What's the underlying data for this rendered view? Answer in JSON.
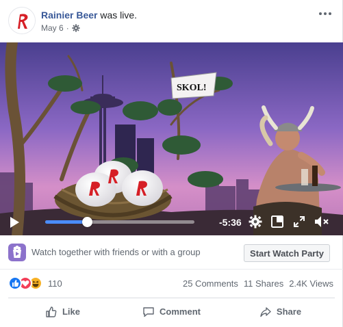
{
  "header": {
    "page_name": "Rainier Beer",
    "status": " was live.",
    "date": "May 6",
    "separator": "·",
    "privacy_icon": "gear-icon",
    "more_icon": "more-options-icon",
    "avatar_color": "#d61f26"
  },
  "video": {
    "flag_text": "SKOL!",
    "time_remaining": "-5:36",
    "progress_fraction": 0.28,
    "accent_color": "#4a8cff"
  },
  "watch_party": {
    "prompt": "Watch together with friends or with a group",
    "button_label": "Start Watch Party",
    "icon_color": "#8c72cb"
  },
  "reactions": {
    "count": "110",
    "types": [
      "like",
      "love",
      "haha"
    ],
    "comments": "25 Comments",
    "shares": "11 Shares",
    "views": "2.4K Views"
  },
  "actions": {
    "like": "Like",
    "comment": "Comment",
    "share": "Share"
  }
}
